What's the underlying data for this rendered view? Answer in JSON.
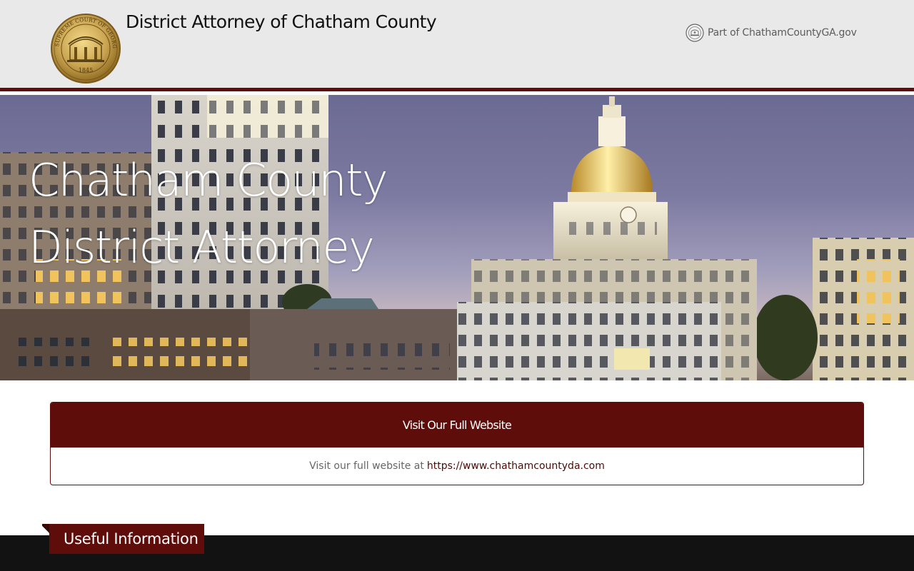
{
  "header": {
    "seal_alt": "Supreme Court of Georgia seal",
    "seal_text": {
      "ring": "SUPREME COURT OF GEORGIA",
      "year": "1845"
    },
    "site_title": "District Attorney of Chatham County",
    "part_of_label": "Part of ChathamCountyGA.gov",
    "mini_seal_icon": "county-seal-icon"
  },
  "hero": {
    "title_line1": "Chatham County",
    "title_line2": "District Attorney",
    "scene": "Savannah skyline at dusk with gold-domed City Hall"
  },
  "panel": {
    "heading": "Visit Our Full Website",
    "body_prefix": "Visit our full website at",
    "link_text": "https://www.chathamcountyda.com"
  },
  "footer": {
    "section_tab": "Useful Information"
  },
  "colors": {
    "brand_maroon": "#5e0d0a",
    "header_bg": "#e9e9ea",
    "footer_dark": "#121212"
  }
}
